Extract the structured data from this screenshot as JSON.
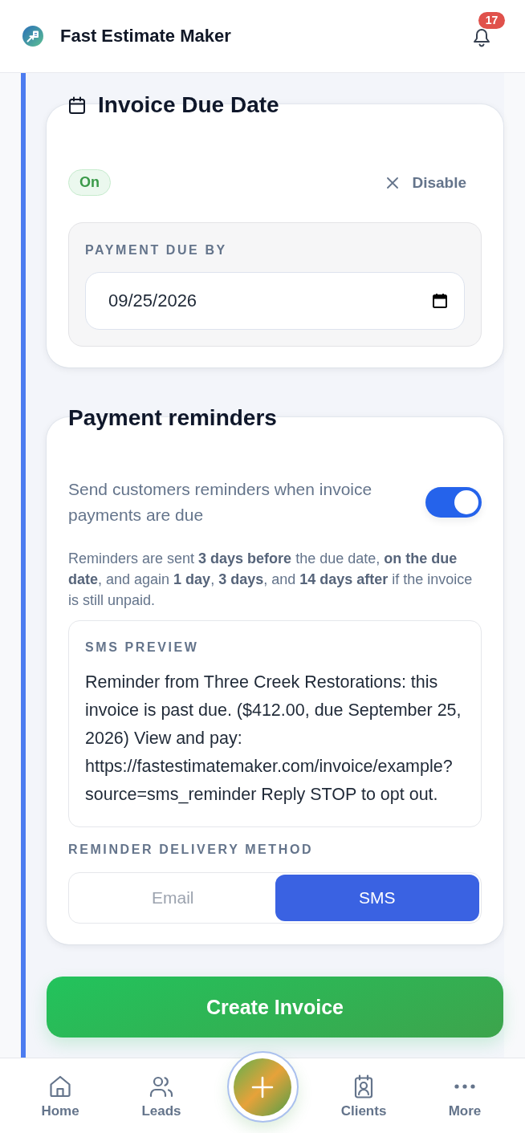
{
  "header": {
    "title": "Fast Estimate Maker",
    "notification_count": "17"
  },
  "due_date": {
    "title": "Invoice Due Date",
    "status": {
      "label": "On",
      "on": true
    },
    "disable_button": "Disable",
    "field_label": "PAYMENT DUE BY",
    "date_value": "09/25/2026"
  },
  "reminders": {
    "title": "Payment reminders",
    "toggle": {
      "label": "Send customers reminders when invoice payments are due",
      "on": true
    },
    "schedule_note": "Reminders are sent **3 days before** the due date, **on the due date**, and again **1 day**, **3 days**, and **14 days after** if the invoice is still unpaid.",
    "preview": {
      "label": "SMS PREVIEW",
      "text": "Reminder from Three Creek Restorations: this invoice is past due. ($412.00, due September 25, 2026) View and pay: https://fastestimatemaker.com/invoice/example?source=sms_reminder Reply STOP to opt out."
    },
    "delivery": {
      "label": "REMINDER DELIVERY METHOD",
      "options": [
        {
          "label": "Email",
          "selected": false
        },
        {
          "label": "SMS",
          "selected": true
        }
      ]
    }
  },
  "primary_action": "Create Invoice",
  "bottom_nav": [
    {
      "kind": "home",
      "label": "Home"
    },
    {
      "kind": "leads",
      "label": "Leads"
    },
    {
      "kind": "add"
    },
    {
      "kind": "clients",
      "label": "Clients"
    },
    {
      "kind": "more",
      "label": "More"
    }
  ]
}
